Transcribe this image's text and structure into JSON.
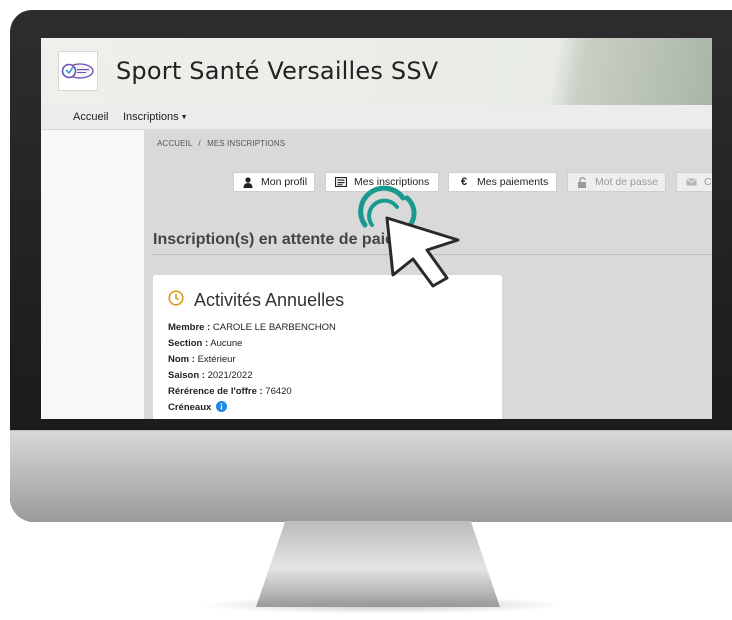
{
  "site": {
    "title": "Sport Santé Versailles SSV"
  },
  "nav": {
    "home": "Accueil",
    "inscriptions": "Inscriptions"
  },
  "breadcrumb": {
    "home": "ACCUEIL",
    "separator": "/",
    "current": "MES INSCRIPTIONS"
  },
  "tabs": [
    {
      "label": "Mon profil",
      "icon": "user-icon"
    },
    {
      "label": "Mes inscriptions",
      "icon": "list-icon"
    },
    {
      "label": "Mes paiements",
      "icon": "euro-icon"
    },
    {
      "label": "Mot de passe",
      "icon": "unlock-icon",
      "disabled": true
    },
    {
      "label": "C",
      "icon": "envelope-icon",
      "disabled": true
    }
  ],
  "section": {
    "title": "Inscription(s) en attente de paieme"
  },
  "card": {
    "title": "Activités Annuelles",
    "icon": "clock-icon",
    "accent": "#d4a017",
    "fields": [
      {
        "label": "Membre :",
        "value": "CAROLE LE BARBENCHON"
      },
      {
        "label": "Section :",
        "value": "Aucune"
      },
      {
        "label": "Nom :",
        "value": "Extérieur"
      },
      {
        "label": "Saison :",
        "value": "2021/2022"
      },
      {
        "label": "Rérérence de l'offre :",
        "value": "76420"
      },
      {
        "label": "Créneaux",
        "value": ""
      }
    ],
    "info_icon": "info-icon"
  },
  "colors": {
    "info_blue": "#1e88e5",
    "cursor_ring": "#1a9a8e"
  }
}
